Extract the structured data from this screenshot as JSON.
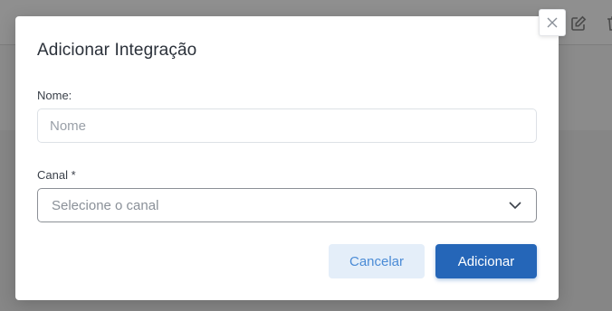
{
  "modal": {
    "title": "Adicionar Integração",
    "close_icon": "close-icon"
  },
  "form": {
    "name_label": "Nome:",
    "name_placeholder": "Nome",
    "name_value": "",
    "channel_label": "Canal *",
    "channel_placeholder": "Selecione o canal",
    "channel_icon": "chevron-down-icon"
  },
  "actions": {
    "cancel_label": "Cancelar",
    "add_label": "Adicionar"
  },
  "background": {
    "icons": [
      "edit-icon",
      "trash-icon"
    ]
  },
  "colors": {
    "primary": "#2566b8",
    "secondary_bg": "#e4eef9",
    "secondary_text": "#4a8bd6",
    "overlay": "#8e8e8e"
  }
}
